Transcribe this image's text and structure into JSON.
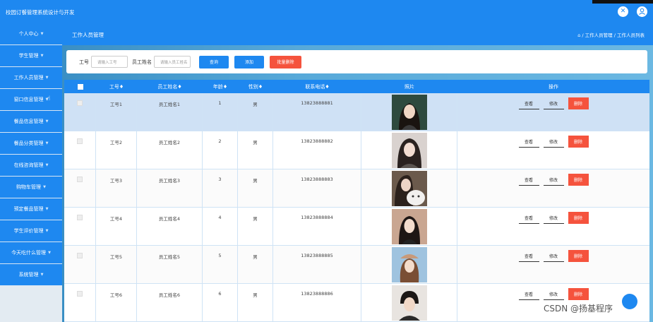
{
  "app": {
    "title": "校园订餐管理系统设计与开发",
    "fullscreen_icon": "fullscreen-icon",
    "user_icon": "user-icon"
  },
  "sidebar": {
    "items": [
      {
        "label": "个人中心"
      },
      {
        "label": "学生管理"
      },
      {
        "label": "工作人员管理"
      },
      {
        "label": "窗口信息管理"
      },
      {
        "label": "餐品信息管理"
      },
      {
        "label": "餐品分类管理"
      },
      {
        "label": "在线咨询管理"
      },
      {
        "label": "购物车管理"
      },
      {
        "label": "预定餐品管理"
      },
      {
        "label": "学生评价管理"
      },
      {
        "label": "今天吃什么管理"
      },
      {
        "label": "系统管理"
      }
    ]
  },
  "header": {
    "page_title": "工作人员管理",
    "breadcrumb": "⌂ / 工作人员管理 / 工作人员列表"
  },
  "filter": {
    "id_label": "工号",
    "id_placeholder": "请输入工号",
    "name_label": "员工姓名",
    "name_placeholder": "请输入员工姓名",
    "search_label": "查询",
    "add_label": "添加",
    "batch_delete_label": "批量删除"
  },
  "table": {
    "columns": [
      "工号♦",
      "员工姓名♦",
      "年龄♦",
      "性别♦",
      "联系电话♦",
      "照片",
      "操作"
    ],
    "rows": [
      {
        "id": "工号1",
        "name": "员工姓名1",
        "age": "1",
        "gender": "男",
        "phone": "13823888881"
      },
      {
        "id": "工号2",
        "name": "员工姓名2",
        "age": "2",
        "gender": "男",
        "phone": "13823888882"
      },
      {
        "id": "工号3",
        "name": "员工姓名3",
        "age": "3",
        "gender": "男",
        "phone": "13823888883"
      },
      {
        "id": "工号4",
        "name": "员工姓名4",
        "age": "4",
        "gender": "男",
        "phone": "13823888884"
      },
      {
        "id": "工号5",
        "name": "员工姓名5",
        "age": "5",
        "gender": "男",
        "phone": "13823888885"
      },
      {
        "id": "工号6",
        "name": "员工姓名6",
        "age": "6",
        "gender": "男",
        "phone": "13823888886"
      }
    ],
    "actions": {
      "view": "查看",
      "edit": "修改",
      "delete": "删除"
    }
  },
  "watermark": "CSDN @扬基程序",
  "colors": {
    "primary": "#1e88f0",
    "danger": "#f5533d"
  }
}
